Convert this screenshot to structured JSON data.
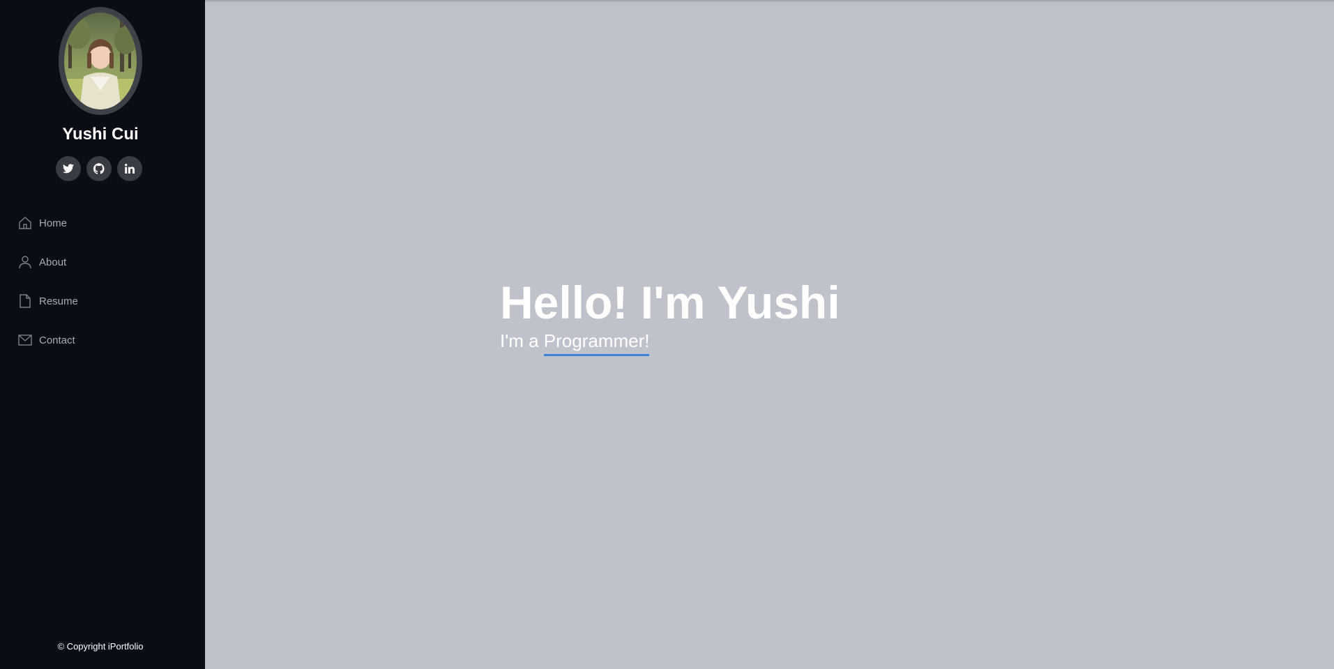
{
  "profile": {
    "name": "Yushi Cui"
  },
  "social": [
    {
      "icon": "twitter-icon"
    },
    {
      "icon": "github-icon"
    },
    {
      "icon": "linkedin-icon"
    }
  ],
  "nav": {
    "items": [
      {
        "label": "Home",
        "icon": "home-icon"
      },
      {
        "label": "About",
        "icon": "user-icon"
      },
      {
        "label": "Resume",
        "icon": "file-icon"
      },
      {
        "label": "Contact",
        "icon": "envelope-icon"
      }
    ]
  },
  "hero": {
    "title": "Hello! I'm Yushi",
    "sub_prefix": "I'm a",
    "typed": "Programmer!"
  },
  "footer": {
    "copyright": "© Copyright iPortfolio"
  },
  "colors": {
    "sidebar_bg": "#0a0d15",
    "main_bg": "#bfc2ca",
    "accent": "#3b82d6"
  }
}
